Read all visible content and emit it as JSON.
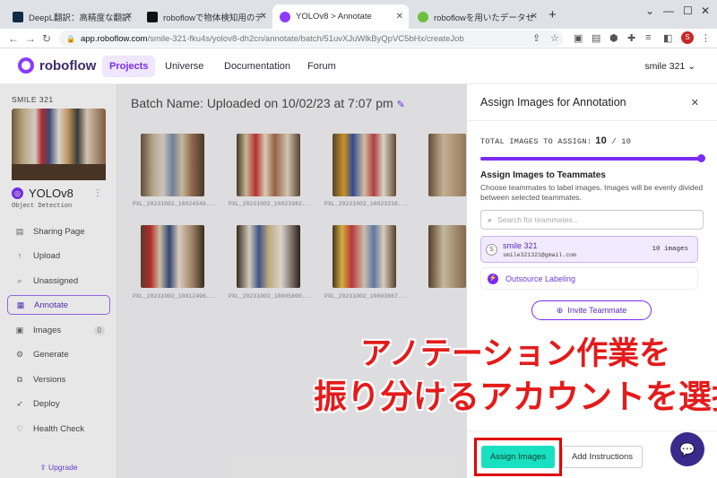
{
  "browser": {
    "tabs": [
      {
        "title": "DeepL翻訳：高精度な翻訳ツール",
        "icon": "deepl-icon",
        "color": "#0f2b46"
      },
      {
        "title": "roboflowで物体検知用のデータセット",
        "icon": "notion-icon",
        "color": "#111111"
      },
      {
        "title": "YOLOv8 > Annotate",
        "icon": "roboflow-icon",
        "color": "#8b3dff"
      },
      {
        "title": "roboflowを用いたデータセットのアノ",
        "icon": "site-icon",
        "color": "#6fbf3f"
      }
    ],
    "new_tab": "+",
    "url_domain": "app.roboflow.com",
    "url_path": "/smile-321-fku4s/yolov8-dh2cn/annotate/batch/51uvXJuWlkByQpVC5bHx/createJob",
    "profile_initial": "S"
  },
  "appnav": {
    "brand": "roboflow",
    "links": [
      "Projects",
      "Universe",
      "Documentation",
      "Forum"
    ],
    "user": "smile 321"
  },
  "sidebar": {
    "workspace": "SMILE 321",
    "project_name": "YOLOv8",
    "project_type": "Object Detection",
    "items": [
      {
        "label": "Sharing Page",
        "icon": "layout-icon"
      },
      {
        "label": "Upload",
        "icon": "upload-icon"
      },
      {
        "label": "Unassigned",
        "icon": "search-icon"
      },
      {
        "label": "Annotate",
        "icon": "annotate-icon"
      },
      {
        "label": "Images",
        "icon": "images-icon",
        "badge": "0"
      },
      {
        "label": "Generate",
        "icon": "generate-icon"
      },
      {
        "label": "Versions",
        "icon": "versions-icon"
      },
      {
        "label": "Deploy",
        "icon": "deploy-icon"
      },
      {
        "label": "Health Check",
        "icon": "health-icon"
      }
    ],
    "upgrade": "Upgrade"
  },
  "main": {
    "batch_title": "Batch Name: Uploaded on 10/02/23 at 7:07 pm",
    "images": [
      {
        "caption": "PXL_20231002_10024546..."
      },
      {
        "caption": "PXL_20231002_10023982..."
      },
      {
        "caption": "PXL_20231002_10023216..."
      },
      {
        "caption": "PXL_20231002_10012496..."
      },
      {
        "caption": "PXL_20231002_10005800..."
      },
      {
        "caption": "PXL_20231002_10003867..."
      }
    ]
  },
  "panel": {
    "title": "Assign Images for Annotation",
    "total_label": "TOTAL IMAGES TO ASSIGN:",
    "total_value": "10",
    "total_sep": "/",
    "total_max": "10",
    "section_title": "Assign Images to Teammates",
    "section_desc": "Choose teammates to label images. Images will be evenly divided between selected teammates.",
    "search_placeholder": "Search for teammates...",
    "member": {
      "initial": "S",
      "name": "smile 321",
      "email": "smile321321@gmail.com",
      "count": "10 images"
    },
    "outsource": "Outsource Labeling",
    "invite": "Invite Teammate",
    "assign_button": "Assign Images",
    "instructions_button": "Add Instructions"
  },
  "annotation_overlay": {
    "line1": "アノテーション作業を",
    "line2": "振り分けるアカウントを選択"
  }
}
